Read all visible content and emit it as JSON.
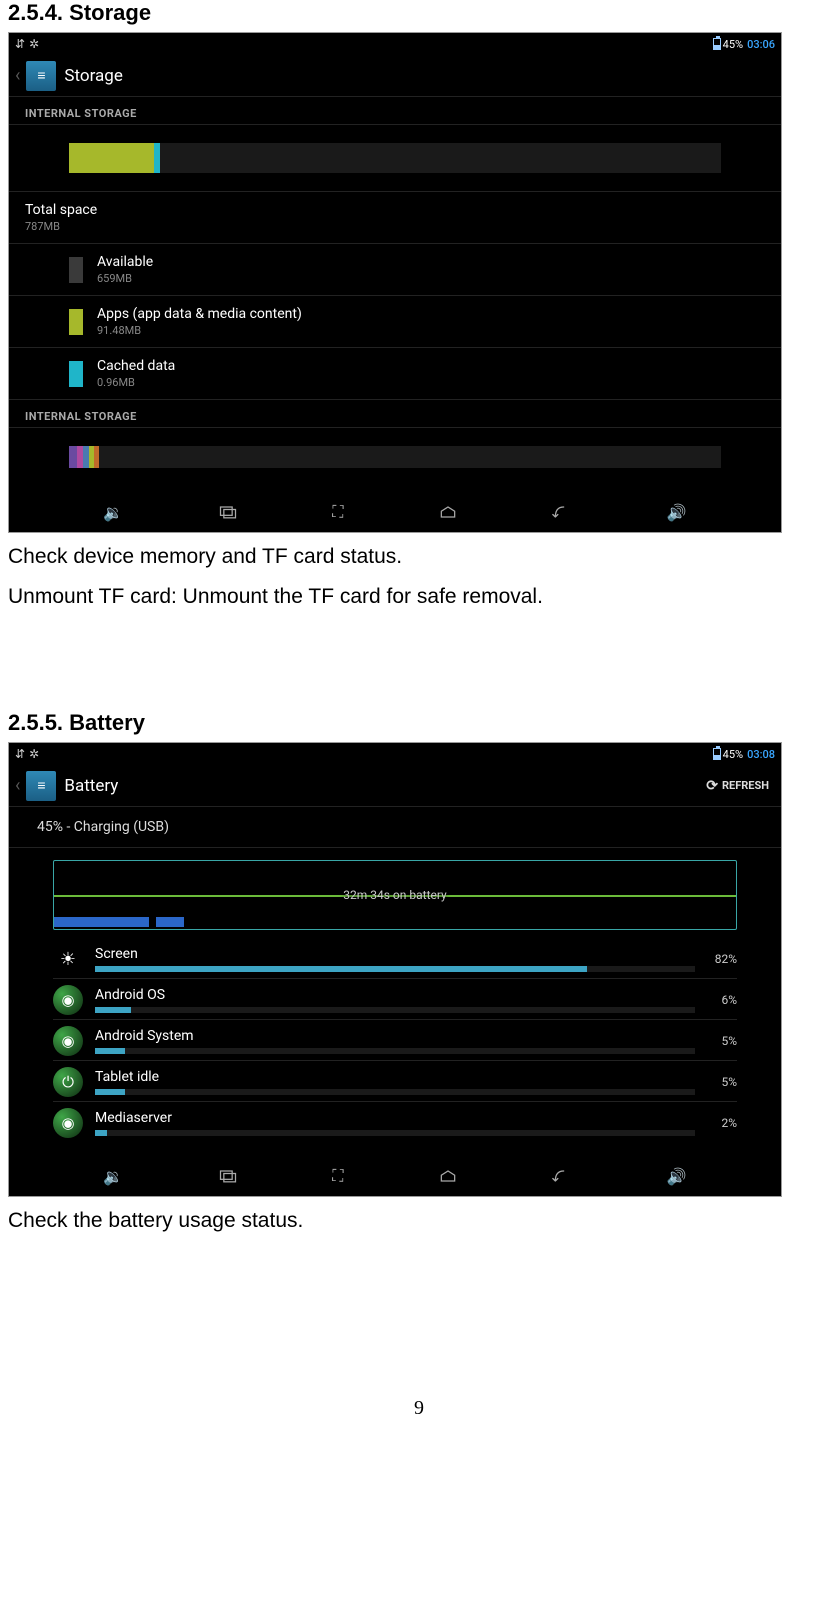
{
  "doc": {
    "heading_storage": "2.5.4. Storage",
    "text_storage_1": "Check device memory and TF card status.",
    "text_storage_2": "Unmount TF card: Unmount the TF card for safe removal.",
    "heading_battery": "2.5.5. Battery",
    "text_battery_1": "Check the battery usage status.",
    "page_number": "9"
  },
  "storage": {
    "statusbar": {
      "battery_pct": "45%",
      "time": "03:06"
    },
    "title": "Storage",
    "section1_label": "INTERNAL STORAGE",
    "bar_segments": [
      {
        "color": "#a6b82b",
        "pct": 13
      },
      {
        "color": "#1fb5c9",
        "pct": 1
      }
    ],
    "total": {
      "label": "Total space",
      "value": "787MB"
    },
    "items": [
      {
        "swatch": "#3a3a3a",
        "label": "Available",
        "value": "659MB"
      },
      {
        "swatch": "#a6b82b",
        "label": "Apps (app data & media content)",
        "value": "91.48MB"
      },
      {
        "swatch": "#1fb5c9",
        "label": "Cached data",
        "value": "0.96MB"
      }
    ],
    "section2_label": "INTERNAL STORAGE",
    "bar2_segments": [
      {
        "color": "#6a4aa0",
        "pct": 1.2
      },
      {
        "color": "#b04aa0",
        "pct": 1.0
      },
      {
        "color": "#4a7ab0",
        "pct": 0.8
      },
      {
        "color": "#a6b82b",
        "pct": 0.8
      },
      {
        "color": "#c06a2a",
        "pct": 0.8
      }
    ]
  },
  "battery": {
    "statusbar": {
      "battery_pct": "45%",
      "time": "03:08"
    },
    "title": "Battery",
    "refresh_label": "REFRESH",
    "status_text": "45% - Charging (USB)",
    "chart_label": "32m 34s on battery",
    "bottom_strip": [
      {
        "color": "#2b67c9",
        "pct": 14
      },
      {
        "color": "#000",
        "pct": 1
      },
      {
        "color": "#2b67c9",
        "pct": 4
      }
    ],
    "usage": [
      {
        "icon": "screen",
        "name": "Screen",
        "pct": "82%",
        "bar": 82
      },
      {
        "icon": "android",
        "name": "Android OS",
        "pct": "6%",
        "bar": 6
      },
      {
        "icon": "android",
        "name": "Android System",
        "pct": "5%",
        "bar": 5
      },
      {
        "icon": "idle",
        "name": "Tablet idle",
        "pct": "5%",
        "bar": 5
      },
      {
        "icon": "android",
        "name": "Mediaserver",
        "pct": "2%",
        "bar": 2
      }
    ]
  }
}
